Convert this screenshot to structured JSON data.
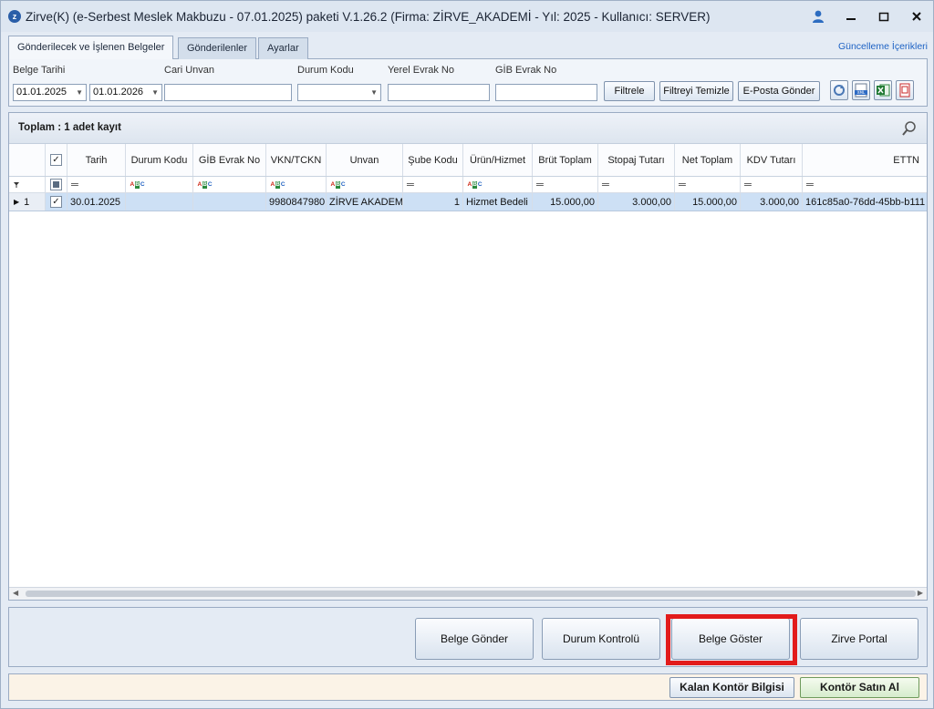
{
  "window": {
    "title": "Zirve(K)  (e-Serbest Meslek Makbuzu - 07.01.2025) paketi V.1.26.2 (Firma: ZİRVE_AKADEMİ - Yıl: 2025 - Kullanıcı: SERVER)"
  },
  "tabs": [
    {
      "label": "Gönderilecek ve İşlenen Belgeler"
    },
    {
      "label": "Gönderilenler"
    },
    {
      "label": "Ayarlar"
    }
  ],
  "update_link": "Güncelleme İçerikleri",
  "filters": {
    "belge_tarihi_label": "Belge Tarihi",
    "date_from": "01.01.2025",
    "date_to": "01.01.2026",
    "cari_unvan_label": "Cari Unvan",
    "durum_kodu_label": "Durum Kodu",
    "yerel_evrak_label": "Yerel Evrak No",
    "gib_evrak_label": "GİB Evrak No",
    "filtrele": "Filtrele",
    "filtreyi_temizle": "Filtreyi Temizle",
    "eposta_gonder": "E-Posta Gönder"
  },
  "grid": {
    "summary": "Toplam : 1 adet kayıt",
    "columns": [
      "Tarih",
      "Durum Kodu",
      "GİB Evrak No",
      "VKN/TCKN",
      "Unvan",
      "Şube Kodu",
      "Ürün/Hizmet",
      "Brüt Toplam",
      "Stopaj Tutarı",
      "Net Toplam",
      "KDV Tutarı",
      "ETTN"
    ],
    "rows": [
      {
        "row_no": "1",
        "tarih": "30.01.2025",
        "durum_kodu": "",
        "gib_evrak_no": "",
        "vkn": "9980847980",
        "unvan": "ZİRVE AKADEMİ",
        "sube_kodu": "1",
        "urun": "Hizmet Bedeli",
        "brut": "15.000,00",
        "stopaj": "3.000,00",
        "net": "15.000,00",
        "kdv": "3.000,00",
        "ettn": "161c85a0-76dd-45bb-b111"
      }
    ]
  },
  "actions": {
    "belge_gonder": "Belge Gönder",
    "durum_kontrolu": "Durum Kontrolü",
    "belge_goster": "Belge Göster",
    "zirve_portal": "Zirve Portal"
  },
  "status": {
    "kalan_kontor": "Kalan Kontör Bilgisi",
    "kontor_satin_al": "Kontör Satın Al"
  },
  "colors": {
    "highlight": "#e21b1b",
    "selected_row": "#cde0f5",
    "link": "#1d62c4"
  }
}
